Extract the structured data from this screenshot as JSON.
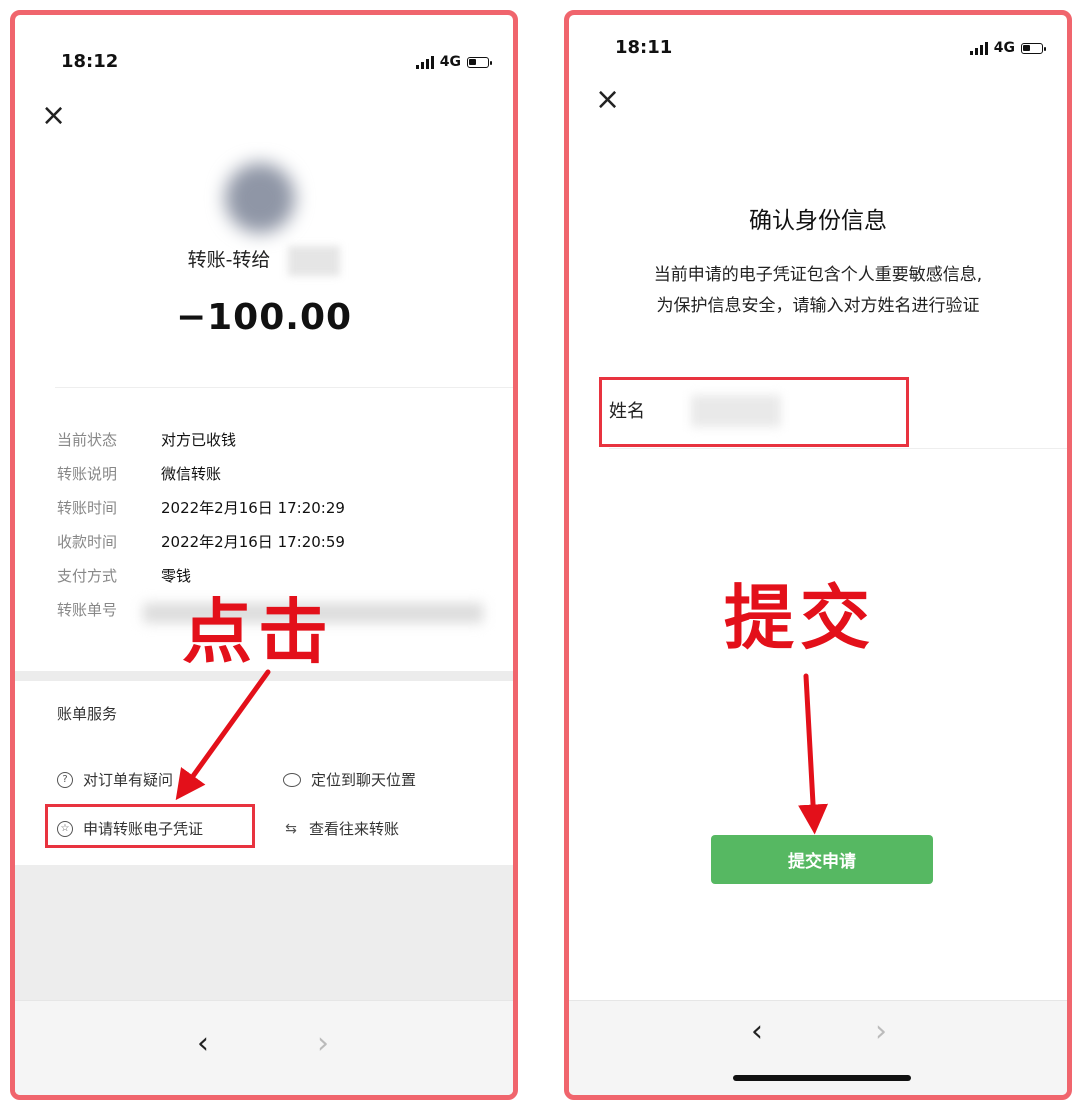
{
  "left": {
    "status": {
      "time": "18:12",
      "network": "4G"
    },
    "transfer": {
      "title": "转账-转给",
      "amount": "−100.00"
    },
    "details": [
      {
        "label": "当前状态",
        "value": "对方已收钱"
      },
      {
        "label": "转账说明",
        "value": "微信转账"
      },
      {
        "label": "转账时间",
        "value": "2022年2月16日 17:20:29"
      },
      {
        "label": "收款时间",
        "value": "2022年2月16日 17:20:59"
      },
      {
        "label": "支付方式",
        "value": "零钱"
      },
      {
        "label": "转账单号",
        "value": ""
      }
    ],
    "bill_services": {
      "title": "账单服务",
      "items": [
        {
          "label": "对订单有疑问",
          "icon": "question-circle-icon"
        },
        {
          "label": "定位到聊天位置",
          "icon": "chat-bubble-icon"
        },
        {
          "label": "申请转账电子凭证",
          "icon": "badge-icon"
        },
        {
          "label": "查看往来转账",
          "icon": "swap-arrows-icon"
        }
      ]
    },
    "annotation": "点击",
    "highlight_color": "#e8333f"
  },
  "right": {
    "status": {
      "time": "18:11",
      "network": "4G"
    },
    "title": "确认身份信息",
    "desc_line1": "当前申请的电子凭证包含个人重要敏感信息,",
    "desc_line2": "为保护信息安全，请输入对方姓名进行验证",
    "name_label": "姓名",
    "submit_label": "提交申请",
    "annotation": "提交",
    "accent_color": "#56b862"
  },
  "frame_color": "#f0656d"
}
